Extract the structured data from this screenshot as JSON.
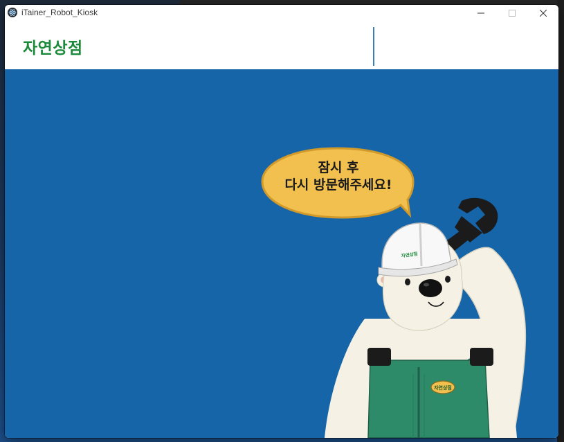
{
  "window": {
    "title": "iTainer_Robot_Kiosk",
    "minimize_label": "minimize",
    "maximize_label": "maximize",
    "close_label": "close"
  },
  "header": {
    "brand": "자연상점"
  },
  "main": {
    "message_line1": "잠시 후",
    "message_line2": "다시 방문해주세요!",
    "helmet_text": "자연상점",
    "badge_text": "자연상점"
  },
  "colors": {
    "brand_green": "#1b8a3a",
    "main_blue": "#1565a8",
    "bubble_yellow": "#f2c04e",
    "overalls_green": "#2e8b6a"
  }
}
